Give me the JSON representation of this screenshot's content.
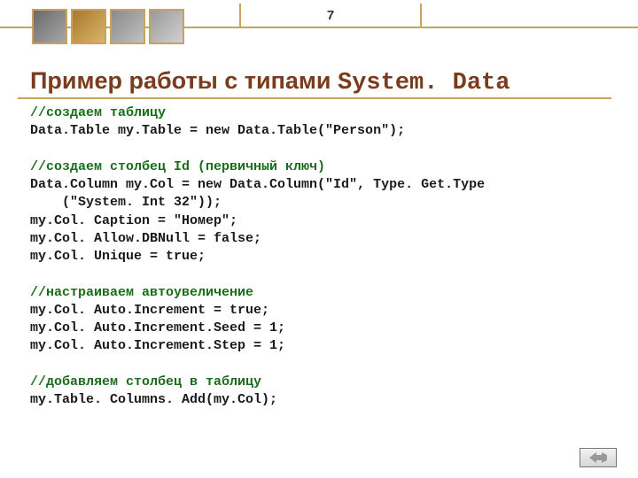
{
  "page_number": "7",
  "title": {
    "prefix": "Пример работы с типами ",
    "mono": "System. Data"
  },
  "code": {
    "block1": {
      "comment": "//создаем таблицу",
      "line1": "Data.Table my.Table = new Data.Table(\"Person\");"
    },
    "block2": {
      "comment": "//создаем столбец Id (первичный ключ)",
      "line1": "Data.Column my.Col = new Data.Column(\"Id\", Type. Get.Type",
      "line2": "    (\"System. Int 32\"));",
      "line3": "my.Col. Caption = \"Номер\";",
      "line4": "my.Col. Allow.DBNull = false;",
      "line5": "my.Col. Unique = true;"
    },
    "block3": {
      "comment": "//настраиваем автоувеличение",
      "line1": "my.Col. Auto.Increment = true;",
      "line2": "my.Col. Auto.Increment.Seed = 1;",
      "line3": "my.Col. Auto.Increment.Step = 1;"
    },
    "block4": {
      "comment": "//добавляем столбец в таблицу",
      "line1": "my.Table. Columns. Add(my.Col);"
    }
  },
  "swatch_colors": [
    "#6a6a6a",
    "#a87a2a",
    "#8a8a8a",
    "#9a9a9a"
  ]
}
